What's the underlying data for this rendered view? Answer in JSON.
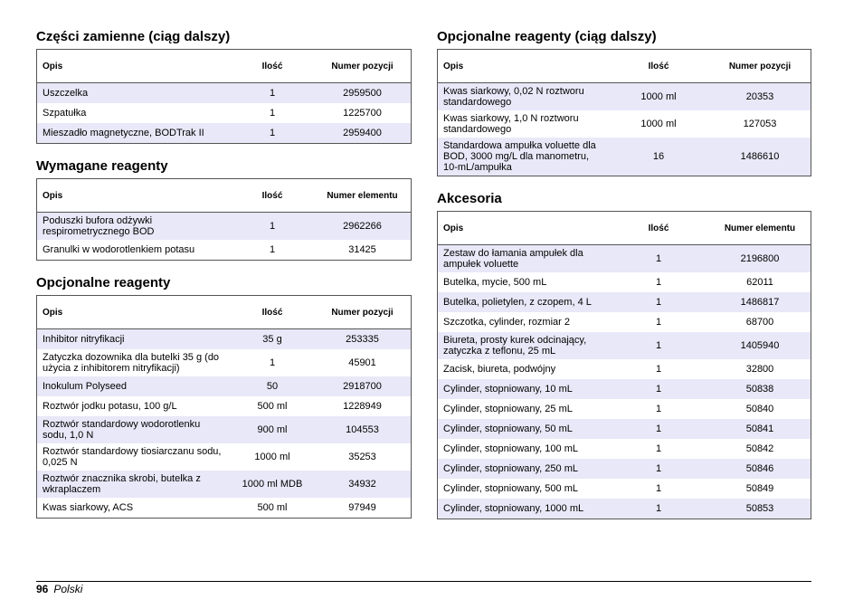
{
  "columns": {
    "desc": "Opis",
    "qty": "Ilość",
    "num_pos": "Numer pozycji",
    "num_elem": "Numer elementu"
  },
  "sections": {
    "parts": {
      "title": "Części zamienne (ciąg dalszy)",
      "rows": [
        {
          "desc": "Uszczelka",
          "qty": "1",
          "num": "2959500"
        },
        {
          "desc": "Szpatułka",
          "qty": "1",
          "num": "1225700"
        },
        {
          "desc": "Mieszadło magnetyczne, BODTrak II",
          "qty": "1",
          "num": "2959400"
        }
      ]
    },
    "required": {
      "title": "Wymagane reagenty",
      "rows": [
        {
          "desc": "Poduszki bufora odżywki respirometrycznego BOD",
          "qty": "1",
          "num": "2962266"
        },
        {
          "desc": "Granulki w wodorotlenkiem potasu",
          "qty": "1",
          "num": "31425"
        }
      ]
    },
    "optional": {
      "title": "Opcjonalne reagenty",
      "rows": [
        {
          "desc": "Inhibitor nitryfikacji",
          "qty": "35 g",
          "num": "253335"
        },
        {
          "desc": "Zatyczka dozownika dla butelki 35 g (do użycia z inhibitorem nitryfikacji)",
          "qty": "1",
          "num": "45901"
        },
        {
          "desc": "Inokulum Polyseed",
          "qty": "50",
          "num": "2918700"
        },
        {
          "desc": "Roztwór jodku potasu, 100 g/L",
          "qty": "500 ml",
          "num": "1228949"
        },
        {
          "desc": "Roztwór standardowy wodorotlenku sodu, 1,0 N",
          "qty": "900 ml",
          "num": "104553"
        },
        {
          "desc": "Roztwór standardowy tiosiarczanu sodu, 0,025 N",
          "qty": "1000 ml",
          "num": "35253"
        },
        {
          "desc": "Roztwór znacznika skrobi, butelka z wkraplaczem",
          "qty": "1000 ml MDB",
          "num": "34932"
        },
        {
          "desc": "Kwas siarkowy, ACS",
          "qty": "500 ml",
          "num": "97949"
        }
      ]
    },
    "optional_cont": {
      "title": "Opcjonalne reagenty (ciąg dalszy)",
      "rows": [
        {
          "desc": "Kwas siarkowy, 0,02 N roztworu standardowego",
          "qty": "1000 ml",
          "num": "20353"
        },
        {
          "desc": "Kwas siarkowy, 1,0 N roztworu standardowego",
          "qty": "1000 ml",
          "num": "127053"
        },
        {
          "desc": "Standardowa ampułka voluette dla BOD, 3000 mg/L dla manometru, 10-mL/ampułka",
          "qty": "16",
          "num": "1486610"
        }
      ]
    },
    "accessories": {
      "title": "Akcesoria",
      "rows": [
        {
          "desc": "Zestaw do łamania ampułek dla ampułek voluette",
          "qty": "1",
          "num": "2196800"
        },
        {
          "desc": "Butelka, mycie, 500 mL",
          "qty": "1",
          "num": "62011"
        },
        {
          "desc": "Butelka, polietylen, z czopem, 4 L",
          "qty": "1",
          "num": "1486817"
        },
        {
          "desc": "Szczotka, cylinder, rozmiar 2",
          "qty": "1",
          "num": "68700"
        },
        {
          "desc": "Biureta, prosty kurek odcinający, zatyczka z teflonu, 25 mL",
          "qty": "1",
          "num": "1405940"
        },
        {
          "desc": "Zacisk, biureta, podwójny",
          "qty": "1",
          "num": "32800"
        },
        {
          "desc": "Cylinder, stopniowany, 10 mL",
          "qty": "1",
          "num": "50838"
        },
        {
          "desc": "Cylinder, stopniowany, 25 mL",
          "qty": "1",
          "num": "50840"
        },
        {
          "desc": "Cylinder, stopniowany, 50 mL",
          "qty": "1",
          "num": "50841"
        },
        {
          "desc": "Cylinder, stopniowany, 100 mL",
          "qty": "1",
          "num": "50842"
        },
        {
          "desc": "Cylinder, stopniowany, 250 mL",
          "qty": "1",
          "num": "50846"
        },
        {
          "desc": "Cylinder, stopniowany, 500 mL",
          "qty": "1",
          "num": "50849"
        },
        {
          "desc": "Cylinder, stopniowany, 1000 mL",
          "qty": "1",
          "num": "50853"
        }
      ]
    }
  },
  "footer": {
    "page_number": "96",
    "language": "Polski"
  },
  "colors": {
    "row_highlight": "#e8e8f8",
    "border": "#555555"
  }
}
